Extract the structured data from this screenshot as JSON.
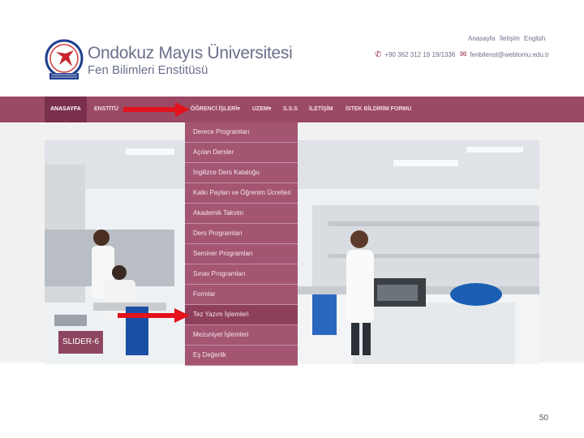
{
  "header": {
    "university": "Ondokuz Mayıs Üniversitesi",
    "institute": "Fen Bilimleri Enstitüsü",
    "toplinks": [
      "Anasayfa",
      "İletişim",
      "English"
    ],
    "phone": "+90 362 312 19 19/1336",
    "email": "fenbilenst@webtomu.edu.tr"
  },
  "nav": {
    "items": [
      "ANASAYFA",
      "ENSTİTÜ",
      "ÖĞRENCİ İŞLERİ",
      "UZEM",
      "S.S.S",
      "İLETİŞİM",
      "İSTEK BİLDİRİM FORMU"
    ],
    "caret": "▾",
    "pointer": "^"
  },
  "dropdown": {
    "items": [
      "Derece Programları",
      "Açılan Dersler",
      "İngilizce Ders Kataloğu",
      "Katkı Payları ve Öğrenim Ücretleri",
      "Akademik Takvim",
      "Ders Programları",
      "Seminer Programları",
      "Sınav Programları",
      "Formlar",
      "Tez Yazım İşlemleri",
      "Mezuniyet İşlemleri",
      "Eş Değerlik"
    ],
    "highlighted": "Tez Yazım İşlemleri"
  },
  "slider": {
    "label": "SLIDER-6"
  },
  "icons": {
    "phone": "phone-icon",
    "email": "mail-icon",
    "logo": "university-logo"
  },
  "colors": {
    "navbar": "#9b4a66",
    "active": "#7a2f4c",
    "dropdown": "#a35572",
    "arrow": "#e3121b"
  },
  "page_number": "50"
}
